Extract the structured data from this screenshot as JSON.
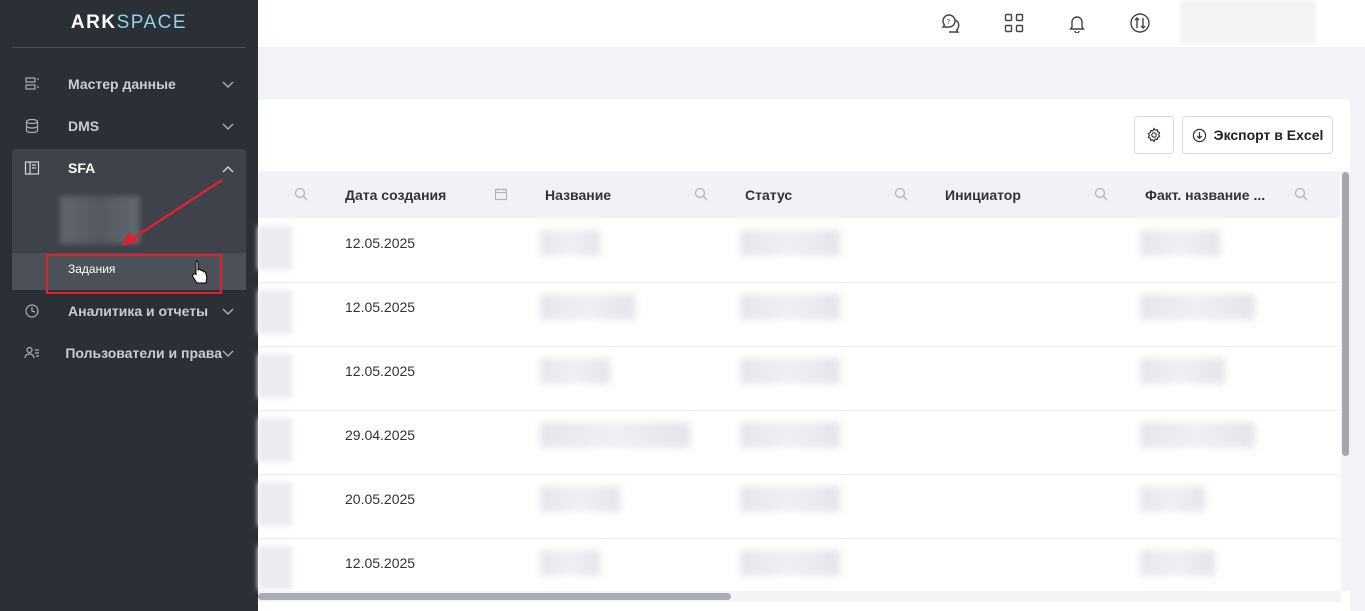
{
  "sidebar": {
    "logo_part1": "ARK",
    "logo_part2": "SPACE",
    "items": [
      {
        "label": "Мастер данные",
        "icon": "master-data-icon"
      },
      {
        "label": "DMS",
        "icon": "database-icon"
      },
      {
        "label": "SFA",
        "icon": "sfa-icon",
        "expanded": true
      },
      {
        "label": "Аналитика и отчеты",
        "icon": "clock-chart-icon"
      },
      {
        "label": "Пользователи и права",
        "icon": "users-icon"
      }
    ],
    "sfa_sub_active": "Задания"
  },
  "header": {
    "icons": [
      "help-chat-icon",
      "apps-grid-icon",
      "bell-icon",
      "sync-icon"
    ]
  },
  "toolbar": {
    "export_label": "Экспорт в Excel"
  },
  "table": {
    "columns": [
      "Дата создания",
      "Название",
      "Статус",
      "Инициатор",
      "Факт. название ..."
    ],
    "rows": [
      {
        "date": "12.05.2025"
      },
      {
        "date": "12.05.2025"
      },
      {
        "date": "12.05.2025"
      },
      {
        "date": "29.04.2025"
      },
      {
        "date": "20.05.2025"
      },
      {
        "date": "12.05.2025"
      }
    ]
  },
  "colors": {
    "sidebar_bg": "#2b2f36",
    "highlight": "#e0212b",
    "logo_accent": "#8fd3e6"
  }
}
